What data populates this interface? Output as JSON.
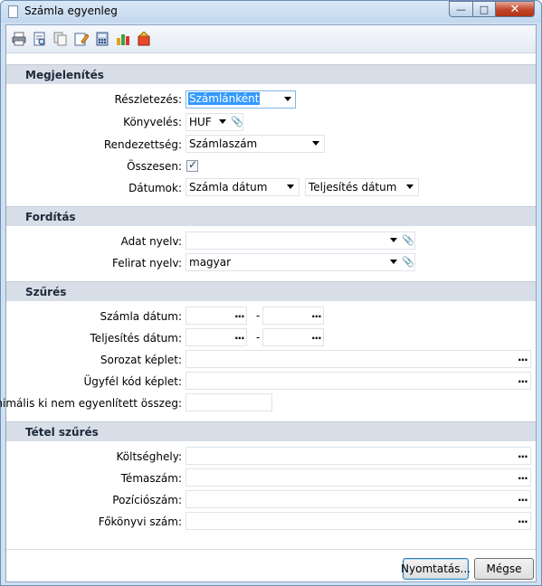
{
  "window": {
    "title": "Számla egyenleg"
  },
  "toolbar": {
    "icons": [
      "print-icon",
      "print-preview-icon",
      "copy-icon",
      "edit-icon",
      "calculator-icon",
      "chart-icon",
      "export-icon"
    ]
  },
  "sections": {
    "display": {
      "title": "Megjelenítés",
      "detail_label": "Részletezés:",
      "detail_value": "Számlánként",
      "accounting_label": "Könyvelés:",
      "accounting_value": "HUF",
      "order_label": "Rendezettség:",
      "order_value": "Számlaszám",
      "total_label": "Összesen:",
      "total_checked": true,
      "dates_label": "Dátumok:",
      "date1_value": "Számla dátum",
      "date2_value": "Teljesítés dátum"
    },
    "translation": {
      "title": "Fordítás",
      "data_lang_label": "Adat nyelv:",
      "data_lang_value": "",
      "caption_lang_label": "Felirat nyelv:",
      "caption_lang_value": "magyar"
    },
    "filter": {
      "title": "Szűrés",
      "invoice_date_label": "Számla dátum:",
      "completion_date_label": "Teljesítés dátum:",
      "series_label": "Sorozat képlet:",
      "client_code_label": "Ügyfél kód képlet:",
      "min_amount_label": "Minimális ki nem egyenlített összeg:",
      "range_sep": "-",
      "ellipsis": "..."
    },
    "item_filter": {
      "title": "Tétel szűrés",
      "cost_center_label": "Költséghely:",
      "topic_label": "Témaszám:",
      "position_label": "Pozíciószám:",
      "ledger_label": "Főkönyvi szám:"
    }
  },
  "buttons": {
    "print": "Nyomtatás...",
    "cancel": "Mégse"
  },
  "colors": {
    "section_bg": "#d7dee7",
    "selection": "#3399ff",
    "titlebar": "#c3d8ee",
    "close": "#c2452a"
  }
}
